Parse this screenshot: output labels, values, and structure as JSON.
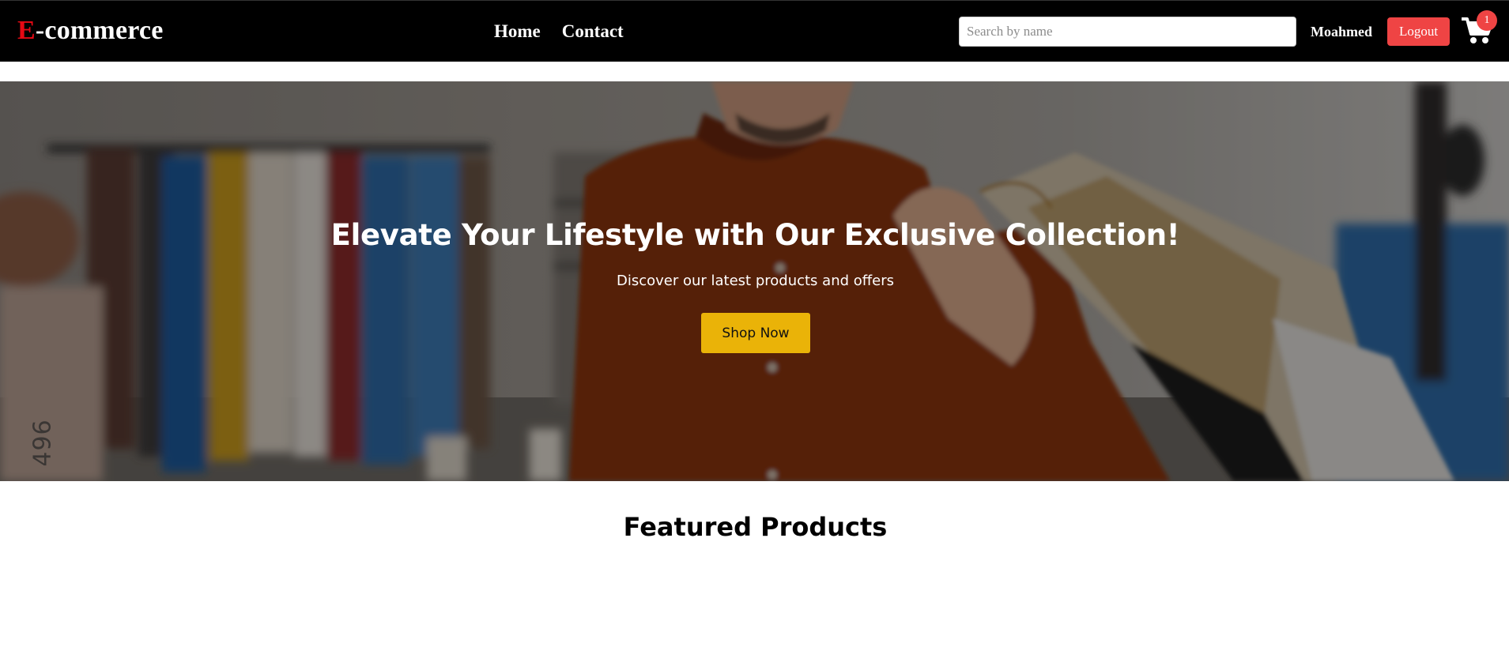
{
  "navbar": {
    "logo_letter": "E",
    "logo_rest": "-commerce",
    "links": [
      "Home",
      "Contact"
    ],
    "search_placeholder": "Search by name",
    "search_value": "",
    "username": "Moahmed",
    "logout_label": "Logout",
    "cart_icon": "shopping-cart-icon",
    "cart_count": "1"
  },
  "hero": {
    "title": "Elevate Your Lifestyle with Our Exclusive Collection!",
    "subtitle": "Discover our latest products and offers",
    "cta_label": "Shop Now",
    "watermark": "496"
  },
  "featured": {
    "title": "Featured Products"
  },
  "colors": {
    "navbar_bg": "#000000",
    "logo_accent": "#e50914",
    "logout_bg": "#ef4444",
    "badge_bg": "#ef4444",
    "cta_bg": "#eab308"
  }
}
